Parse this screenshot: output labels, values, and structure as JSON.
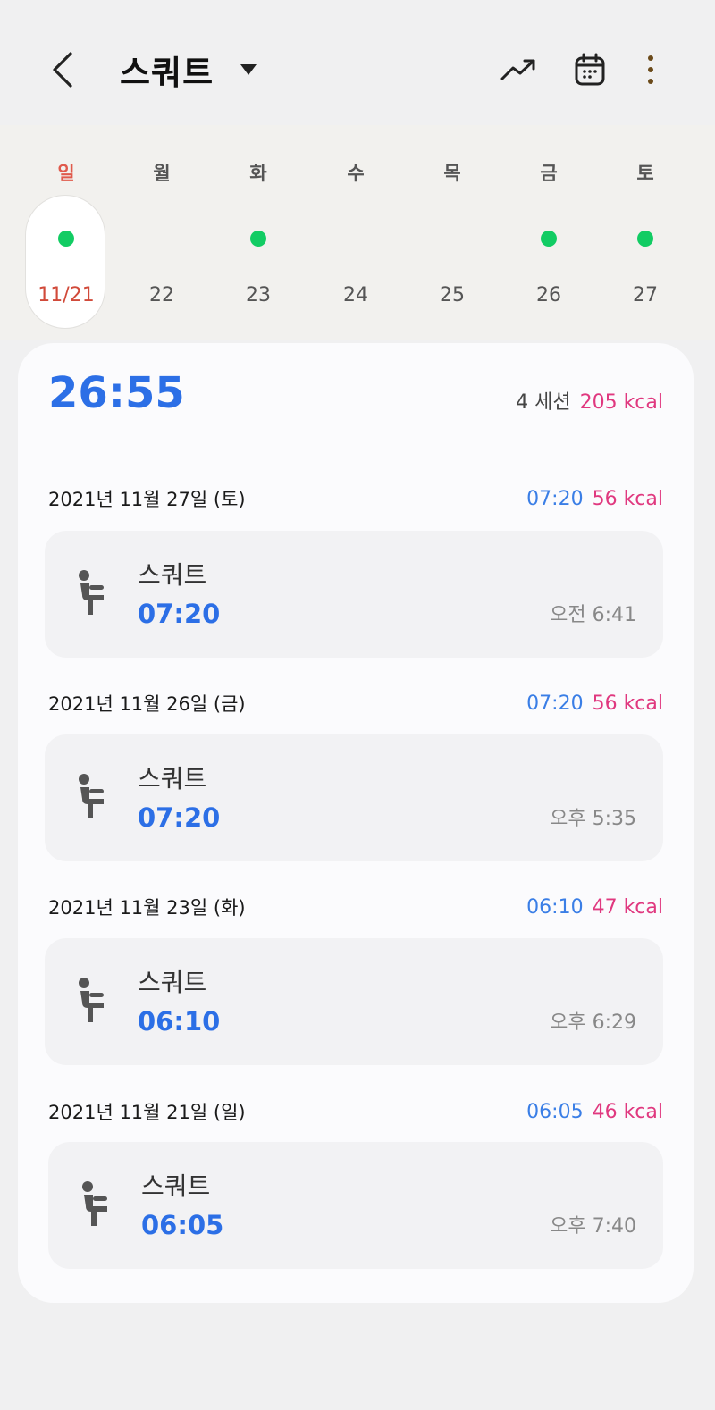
{
  "header": {
    "title": "스쿼트"
  },
  "week": {
    "days": [
      {
        "name": "일",
        "num": "11/21",
        "has_workout": true,
        "selected": true,
        "sunday": true
      },
      {
        "name": "월",
        "num": "22",
        "has_workout": false,
        "selected": false,
        "sunday": false
      },
      {
        "name": "화",
        "num": "23",
        "has_workout": true,
        "selected": false,
        "sunday": false
      },
      {
        "name": "수",
        "num": "24",
        "has_workout": false,
        "selected": false,
        "sunday": false
      },
      {
        "name": "목",
        "num": "25",
        "has_workout": false,
        "selected": false,
        "sunday": false
      },
      {
        "name": "금",
        "num": "26",
        "has_workout": true,
        "selected": false,
        "sunday": false
      },
      {
        "name": "토",
        "num": "27",
        "has_workout": true,
        "selected": false,
        "sunday": false
      }
    ]
  },
  "summary": {
    "total_time": "26:55",
    "sessions": "4 세션",
    "kcal": "205  kcal"
  },
  "groups": [
    {
      "date": "2021년 11월 27일 (토)",
      "time": "07:20",
      "kcal": "56 kcal",
      "session": {
        "name": "스쿼트",
        "duration": "07:20",
        "clock": "오전 6:41"
      }
    },
    {
      "date": "2021년 11월 26일 (금)",
      "time": "07:20",
      "kcal": "56 kcal",
      "session": {
        "name": "스쿼트",
        "duration": "07:20",
        "clock": "오후 5:35"
      }
    },
    {
      "date": "2021년 11월 23일 (화)",
      "time": "06:10",
      "kcal": "47 kcal",
      "session": {
        "name": "스쿼트",
        "duration": "06:10",
        "clock": "오후 6:29"
      }
    },
    {
      "date": "2021년 11월 21일 (일)",
      "time": "06:05",
      "kcal": "46 kcal",
      "session": {
        "name": "스쿼트",
        "duration": "06:05",
        "clock": "오후 7:40"
      }
    }
  ],
  "colors": {
    "accent_blue": "#2c6fe6",
    "kcal_pink": "#e0387f",
    "dot_green": "#12cc63",
    "sunday_red": "#e05a4c"
  },
  "icons": [
    "back-arrow-icon",
    "dropdown-caret-icon",
    "trend-icon",
    "calendar-icon",
    "more-vert-icon",
    "squat-icon"
  ]
}
